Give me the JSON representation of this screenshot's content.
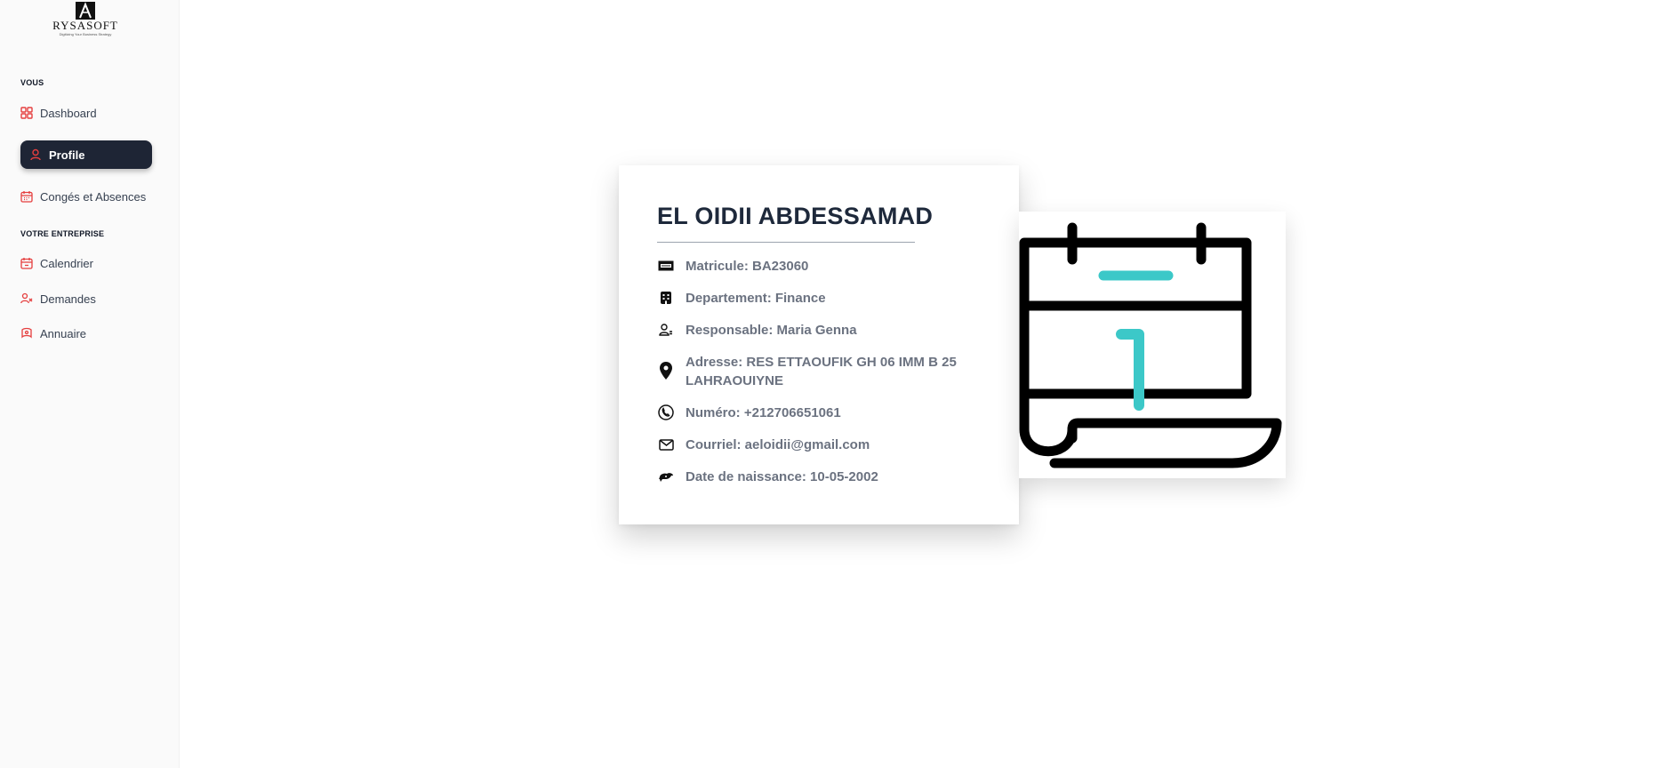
{
  "logo": {
    "brand": "RYSASOFT",
    "tagline": "Digitizing Your Business Strategy"
  },
  "sidebar": {
    "sections": [
      {
        "label": "VOUS"
      },
      {
        "label": "VOTRE ENTREPRISE"
      }
    ],
    "items": [
      {
        "label": "Dashboard",
        "icon": "grid-icon",
        "active": false
      },
      {
        "label": "Profile",
        "icon": "user-icon",
        "active": true
      },
      {
        "label": "Congés et Absences",
        "icon": "calendar-icon",
        "active": false
      },
      {
        "label": "Calendrier",
        "icon": "calendar-icon",
        "active": false
      },
      {
        "label": "Demandes",
        "icon": "users-icon",
        "active": false
      },
      {
        "label": "Annuaire",
        "icon": "book-icon",
        "active": false
      }
    ]
  },
  "profile": {
    "name": "EL OIDII ABDESSAMAD",
    "rows": [
      {
        "icon": "id-card-icon",
        "text": "Matricule: BA23060"
      },
      {
        "icon": "building-icon",
        "text": "Departement: Finance"
      },
      {
        "icon": "manager-icon",
        "text": "Responsable: Maria Genna"
      },
      {
        "icon": "location-pin-icon",
        "text": "Adresse: RES ETTAOUFIK GH 06 IMM B 25 LAHRAOUIYNE"
      },
      {
        "icon": "phone-icon",
        "text": "Numéro: +212706651061"
      },
      {
        "icon": "envelope-icon",
        "text": "Courriel: aeloidii@gmail.com"
      },
      {
        "icon": "cake-icon",
        "text": "Date de naissance: 10-05-2002"
      }
    ]
  },
  "calendar_graphic": {
    "day": "1",
    "accent_color": "#3cc8c8"
  },
  "colors": {
    "sidebar_active_bg": "#1e2535",
    "icon_red": "#e53e3e",
    "accent": "#3cc8c8"
  }
}
